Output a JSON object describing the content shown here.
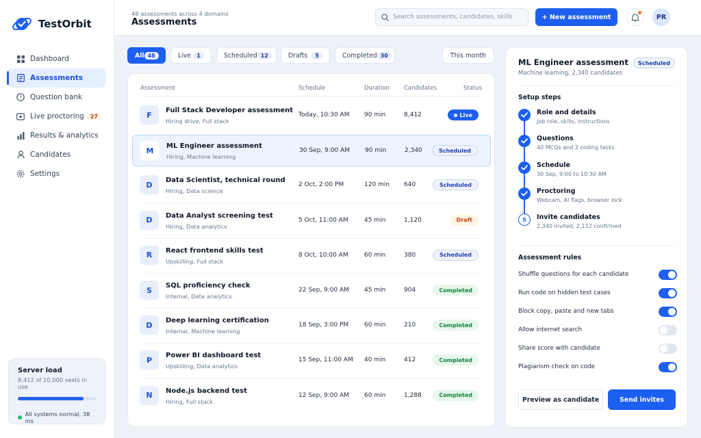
{
  "app": {
    "name": "TestOrbit"
  },
  "sidebar": {
    "items": [
      {
        "label": "Dashboard",
        "icon": "grid-icon"
      },
      {
        "label": "Assessments",
        "icon": "document-icon",
        "active": true
      },
      {
        "label": "Question bank",
        "icon": "question-icon"
      },
      {
        "label": "Live proctoring",
        "icon": "video-icon",
        "badge": "27"
      },
      {
        "label": "Results & analytics",
        "icon": "bar-chart-icon"
      },
      {
        "label": "Candidates",
        "icon": "user-icon"
      },
      {
        "label": "Settings",
        "icon": "gear-icon"
      }
    ],
    "server": {
      "title": "Server load",
      "subtitle": "8,412 of 10,000 seats in use",
      "load_fraction": 0.8412,
      "status": "All systems normal, 38 ms"
    }
  },
  "header": {
    "subtitle": "48 assessments across 4 domains",
    "title": "Assessments",
    "search_placeholder": "Search assessments, candidates, skills",
    "new_button": "+ New assessment",
    "avatar": "PR"
  },
  "filters": {
    "tabs": [
      {
        "label": "All",
        "count": "48",
        "active": true
      },
      {
        "label": "Live",
        "count": "1"
      },
      {
        "label": "Scheduled",
        "count": "12"
      },
      {
        "label": "Drafts",
        "count": "5"
      },
      {
        "label": "Completed",
        "count": "30"
      }
    ],
    "period": "This month"
  },
  "table": {
    "columns": [
      "Assessment",
      "Schedule",
      "Duration",
      "Candidates",
      "Status"
    ],
    "rows": [
      {
        "initial": "F",
        "title": "Full Stack Developer assessment",
        "subtitle": "Hiring drive, Full stack",
        "schedule": "Today, 10:30 AM",
        "duration": "90 min",
        "candidates": "8,412",
        "status": "Live",
        "kind": "live"
      },
      {
        "initial": "M",
        "title": "ML Engineer assessment",
        "subtitle": "Hiring, Machine learning",
        "schedule": "30 Sep, 9:00 AM",
        "duration": "90 min",
        "candidates": "2,340",
        "status": "Scheduled",
        "kind": "scheduled",
        "selected": true
      },
      {
        "initial": "D",
        "title": "Data Scientist, technical round",
        "subtitle": "Hiring, Data science",
        "schedule": "2 Oct, 2:00 PM",
        "duration": "120 min",
        "candidates": "640",
        "status": "Scheduled",
        "kind": "scheduled"
      },
      {
        "initial": "D",
        "title": "Data Analyst screening test",
        "subtitle": "Hiring, Data analytics",
        "schedule": "5 Oct, 11:00 AM",
        "duration": "45 min",
        "candidates": "1,120",
        "status": "Draft",
        "kind": "draft"
      },
      {
        "initial": "R",
        "title": "React frontend skills test",
        "subtitle": "Upskilling, Full stack",
        "schedule": "8 Oct, 10:00 AM",
        "duration": "60 min",
        "candidates": "380",
        "status": "Scheduled",
        "kind": "scheduled"
      },
      {
        "initial": "S",
        "title": "SQL proficiency check",
        "subtitle": "Internal, Data analytics",
        "schedule": "22 Sep, 9:00 AM",
        "duration": "45 min",
        "candidates": "904",
        "status": "Completed",
        "kind": "completed"
      },
      {
        "initial": "D",
        "title": "Deep learning certification",
        "subtitle": "Internal, Machine learning",
        "schedule": "18 Sep, 3:00 PM",
        "duration": "60 min",
        "candidates": "210",
        "status": "Completed",
        "kind": "completed"
      },
      {
        "initial": "P",
        "title": "Power BI dashboard test",
        "subtitle": "Upskilling, Data analytics",
        "schedule": "15 Sep, 11:00 AM",
        "duration": "40 min",
        "candidates": "412",
        "status": "Completed",
        "kind": "completed"
      },
      {
        "initial": "N",
        "title": "Node.js backend test",
        "subtitle": "Hiring, Full stack",
        "schedule": "12 Sep, 9:00 AM",
        "duration": "60 min",
        "candidates": "1,288",
        "status": "Completed",
        "kind": "completed"
      }
    ]
  },
  "details": {
    "title": "ML Engineer assessment",
    "badge": "Scheduled",
    "subtitle": "Machine learning, 2,340 candidates",
    "steps_heading": "Setup steps",
    "steps": [
      {
        "title": "Role and details",
        "subtitle": "Job role, skills, instructions",
        "done": true
      },
      {
        "title": "Questions",
        "subtitle": "40 MCQs and 2 coding tasks",
        "done": true
      },
      {
        "title": "Schedule",
        "subtitle": "30 Sep, 9:00 to 10:30 AM",
        "done": true
      },
      {
        "title": "Proctoring",
        "subtitle": "Webcam, AI flags, browser lock",
        "done": true
      },
      {
        "title": "Invite candidates",
        "subtitle": "2,340 invited, 2,112 confirmed",
        "done": false,
        "number": "5"
      }
    ],
    "rules_heading": "Assessment rules",
    "rules": [
      {
        "label": "Shuffle questions for each candidate",
        "on": true
      },
      {
        "label": "Run code on hidden test cases",
        "on": true
      },
      {
        "label": "Block copy, paste and new tabs",
        "on": true
      },
      {
        "label": "Allow internet search",
        "on": false
      },
      {
        "label": "Share score with candidate",
        "on": false
      },
      {
        "label": "Plagiarism check on code",
        "on": true
      }
    ],
    "preview_button": "Preview as candidate",
    "send_button": "Send invites"
  }
}
